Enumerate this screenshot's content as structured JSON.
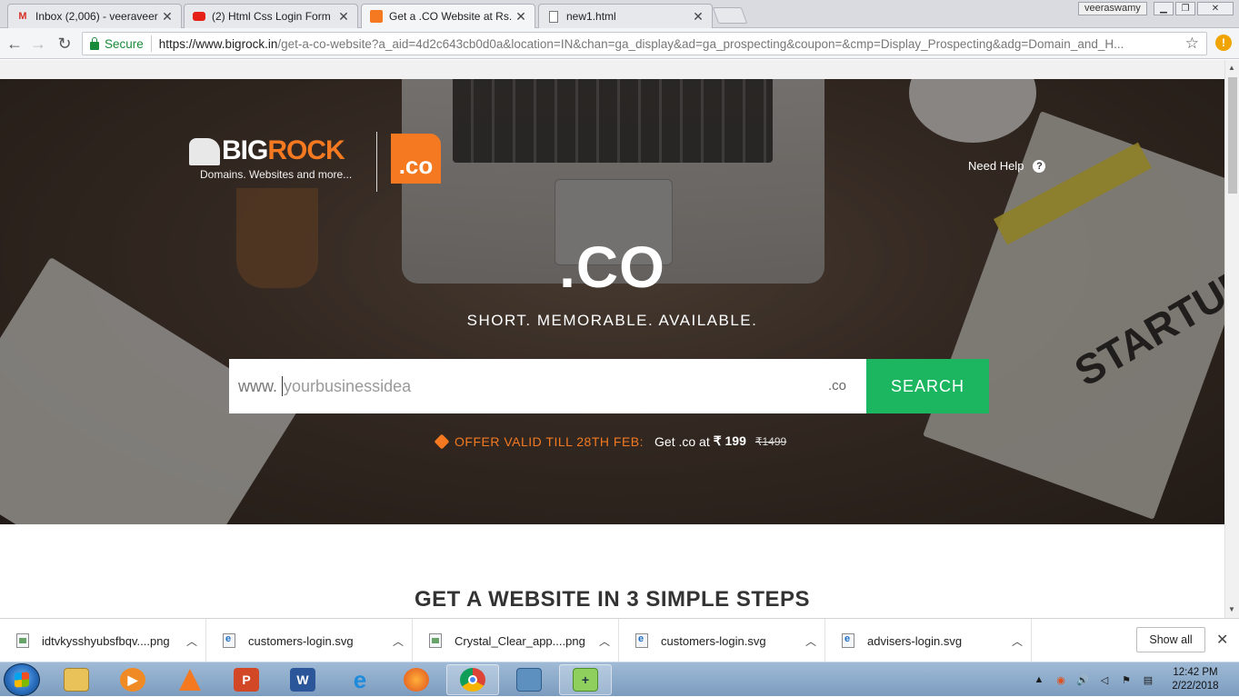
{
  "browser": {
    "tabs": [
      {
        "title": "Inbox (2,006) - veeraveer",
        "icon": "gmail-icon",
        "active": false
      },
      {
        "title": "(2) Html Css Login Form",
        "icon": "youtube-icon",
        "active": false
      },
      {
        "title": "Get a .CO Website at Rs.",
        "icon": "bigrock-icon",
        "active": true
      },
      {
        "title": "new1.html",
        "icon": "file-icon",
        "active": false
      }
    ],
    "user_badge": "veeraswamy",
    "secure_label": "Secure",
    "url_host": "https://www.bigrock.in",
    "url_rest": "/get-a-co-website?a_aid=4d2c643cb0d0a&location=IN&chan=ga_display&ad=ga_prospecting&coupon=&cmp=Display_Prospecting&adg=Domain_and_H..."
  },
  "page": {
    "logo": {
      "big": "BIG",
      "rock": "ROCK",
      "tagline": "Domains. Websites and more...",
      "co_badge": ".co"
    },
    "need_help": "Need Help",
    "hero_title": ".CO",
    "hero_subtitle": "SHORT. MEMORABLE. AVAILABLE.",
    "search": {
      "prefix": "www.",
      "placeholder": "yourbusinessidea",
      "tld": ".co",
      "button": "SEARCH"
    },
    "offer": {
      "valid": "OFFER VALID TILL 28TH FEB:",
      "get": "Get .co at",
      "price": "₹ 199",
      "old_price": "₹1499"
    },
    "steps_title": "GET A WEBSITE IN 3 SIMPLE STEPS"
  },
  "downloads": {
    "items": [
      {
        "name": "idtvkysshyubsfbqv....png",
        "type": "img"
      },
      {
        "name": "customers-login.svg",
        "type": "svg"
      },
      {
        "name": "Crystal_Clear_app....png",
        "type": "img"
      },
      {
        "name": "customers-login.svg",
        "type": "svg"
      },
      {
        "name": "advisers-login.svg",
        "type": "svg"
      }
    ],
    "show_all": "Show all"
  },
  "taskbar": {
    "apps": [
      "explorer",
      "media-player",
      "vlc",
      "powerpoint",
      "word",
      "internet-explorer",
      "firefox",
      "chrome",
      "photo-viewer",
      "notepad-plus"
    ],
    "time": "12:42 PM",
    "date": "2/22/2018"
  },
  "colors": {
    "brand_orange": "#f47920",
    "search_green": "#1cb660"
  }
}
